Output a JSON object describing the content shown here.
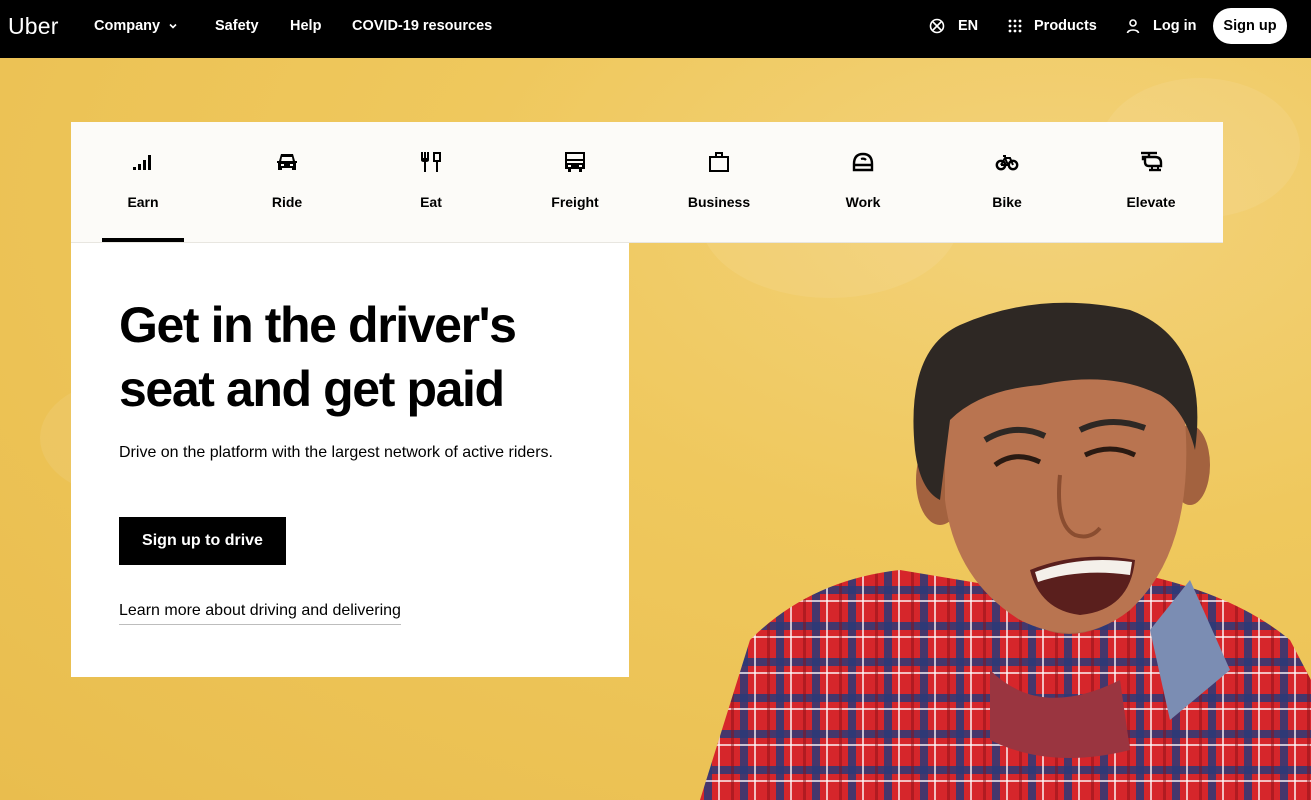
{
  "header": {
    "logo": "Uber",
    "nav": {
      "company": "Company",
      "safety": "Safety",
      "help": "Help",
      "covid": "COVID-19 resources"
    },
    "language": "EN",
    "products": "Products",
    "login": "Log in",
    "signup": "Sign up"
  },
  "tabs": [
    {
      "label": "Earn",
      "icon": "signal-bars-icon",
      "active": true
    },
    {
      "label": "Ride",
      "icon": "car-icon"
    },
    {
      "label": "Eat",
      "icon": "fork-knife-icon"
    },
    {
      "label": "Freight",
      "icon": "truck-icon"
    },
    {
      "label": "Business",
      "icon": "briefcase-icon"
    },
    {
      "label": "Work",
      "icon": "helmet-icon"
    },
    {
      "label": "Bike",
      "icon": "bike-icon"
    },
    {
      "label": "Elevate",
      "icon": "helicopter-icon"
    }
  ],
  "hero": {
    "title": "Get in the driver's seat and get paid",
    "subtitle": "Drive on the platform with the largest network of active riders.",
    "cta": "Sign up to drive",
    "link": "Learn more about driving and delivering"
  },
  "colors": {
    "accent": "#000000",
    "background": "#f1c95c",
    "card": "#ffffff"
  }
}
